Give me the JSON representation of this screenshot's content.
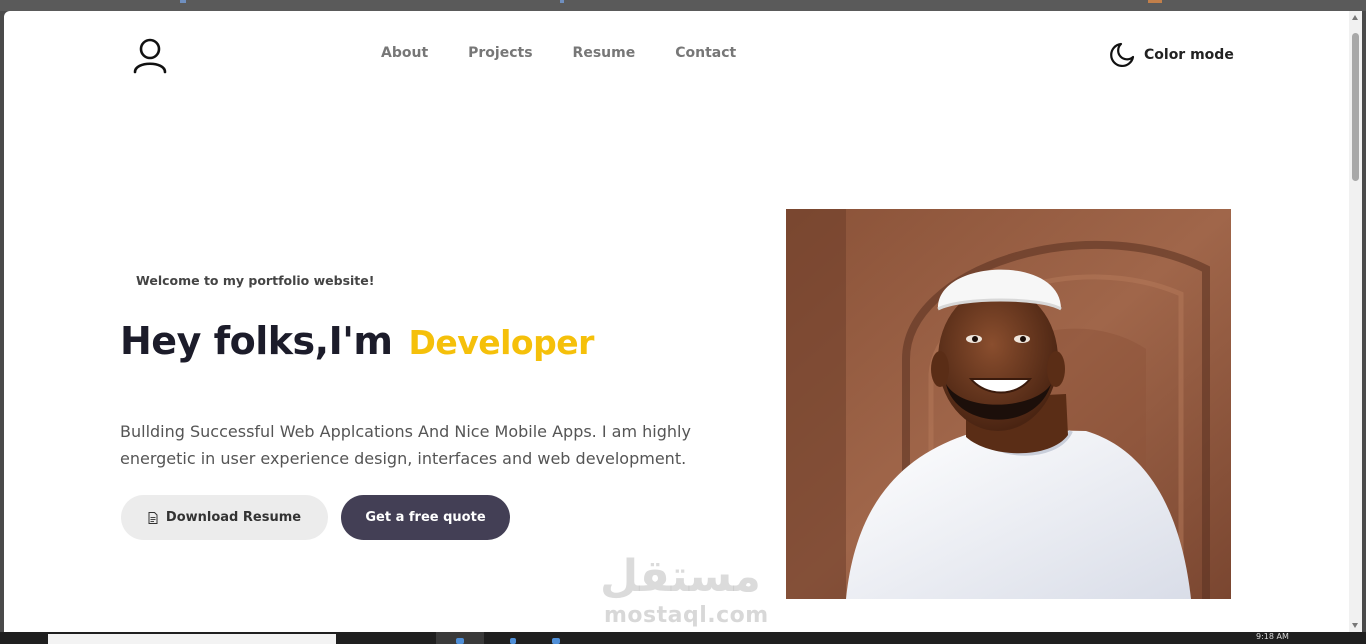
{
  "nav": {
    "items": [
      "About",
      "Projects",
      "Resume",
      "Contact"
    ],
    "color_mode_label": "Color mode"
  },
  "hero": {
    "welcome": "Welcome to my portfolio website!",
    "greeting": "Hey folks,I'm",
    "role": "Developer",
    "intro_line1": "Bullding Successful Web Applcations And Nice Mobile Apps. I am highly",
    "intro_line2": "energetic in user experience design, interfaces and web development.",
    "download_label": "Download Resume",
    "quote_label": "Get a free quote"
  },
  "watermark": {
    "arabic": "مستقل",
    "latin": "mostaql.com"
  },
  "taskbar": {
    "clock": "9:18 AM"
  },
  "colors": {
    "accent": "#f5c00a",
    "primary_button": "#433f55",
    "secondary_button": "#ececec",
    "text_dark": "#1c1c2a",
    "nav_text": "#777777"
  },
  "icons": [
    "user-outline-icon",
    "moon-icon",
    "document-icon"
  ]
}
